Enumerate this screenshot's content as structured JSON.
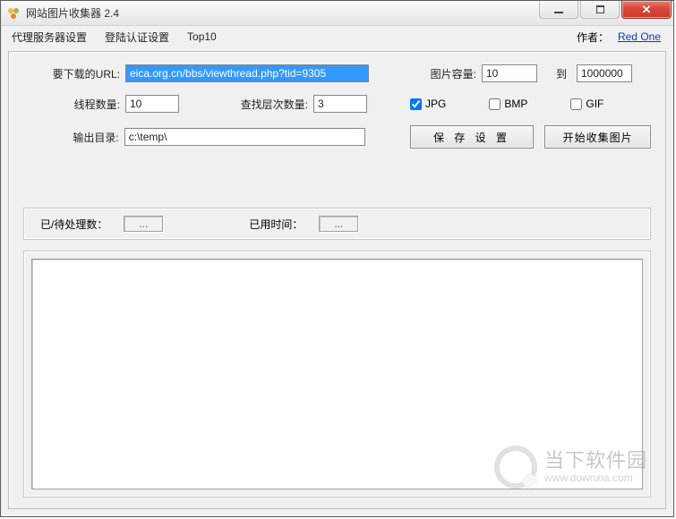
{
  "window": {
    "title": "网站图片收集器 2.4"
  },
  "menu": {
    "proxy": "代理服务器设置",
    "auth": "登陆认证设置",
    "top10": "Top10",
    "author_label": "作者：",
    "author_link": "Red One"
  },
  "form": {
    "url_label": "要下载的URL:",
    "url_value": "eica.org.cn/bbs/viewthread.php?tid=9305",
    "img_cap_label": "图片容量:",
    "img_cap_from": "10",
    "to_label": "到",
    "img_cap_to": "1000000",
    "threads_label": "线程数量:",
    "threads_value": "10",
    "depth_label": "查找层次数量:",
    "depth_value": "3",
    "chk_jpg": "JPG",
    "chk_bmp": "BMP",
    "chk_gif": "GIF",
    "outdir_label": "输出目录:",
    "outdir_value": "c:\\temp\\",
    "btn_save": "保 存 设 置",
    "btn_start": "开始收集图片"
  },
  "status": {
    "pending_label": "已/待处理数：",
    "pending_value": "...",
    "elapsed_label": "已用时间：",
    "elapsed_value": "..."
  },
  "watermark": {
    "zh": "当下软件园",
    "en": "www.downxia.com"
  }
}
